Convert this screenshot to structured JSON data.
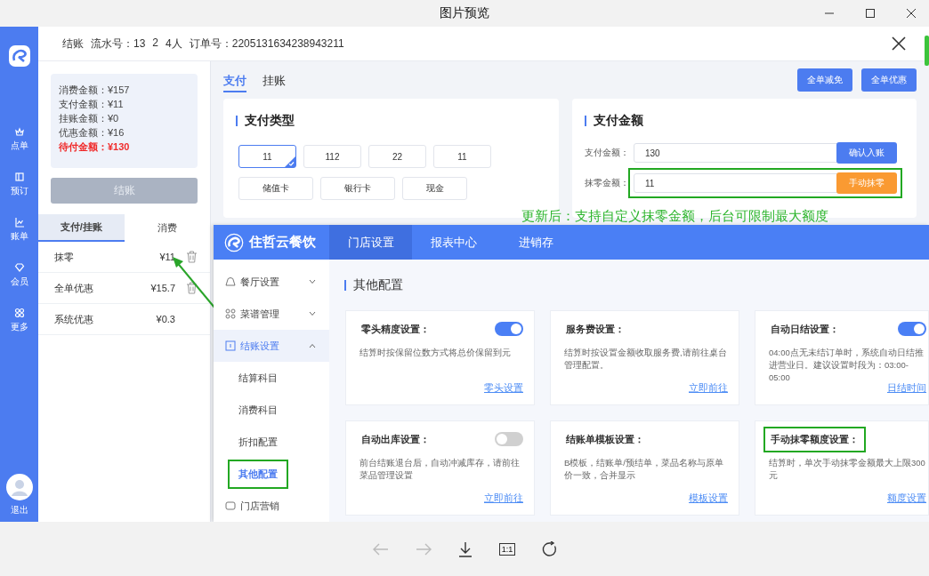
{
  "window": {
    "title": "图片预览"
  },
  "pos": {
    "nav": [
      {
        "label": "点单"
      },
      {
        "label": "预订"
      },
      {
        "label": "账单"
      },
      {
        "label": "会员"
      },
      {
        "label": "更多"
      }
    ],
    "logout": "退出",
    "header": {
      "title": "结账",
      "serial": "流水号：13",
      "table": "2",
      "guests": "4人",
      "order": "订单号：2205131634238943211"
    },
    "summary": [
      {
        "text": "消费金额：¥157",
        "kind": "normal"
      },
      {
        "text": "支付金额：¥11",
        "kind": "normal"
      },
      {
        "text": "挂账金额：¥0",
        "kind": "normal"
      },
      {
        "text": "优惠金额：¥16",
        "kind": "normal"
      },
      {
        "text": "待付金额：¥130",
        "kind": "due"
      }
    ],
    "checkout_button": {
      "label": "结账",
      "disabled": true
    },
    "list_tabs": [
      {
        "label": "支付/挂账",
        "selected": true
      },
      {
        "label": "消费",
        "selected": false
      }
    ],
    "entries": [
      {
        "name": "抹零",
        "amount": "¥11",
        "deletable": true
      },
      {
        "name": "全单优惠",
        "amount": "¥15.7",
        "deletable": true
      },
      {
        "name": "系统优惠",
        "amount": "¥0.3",
        "deletable": false
      }
    ],
    "pay_tabs": [
      {
        "label": "支付",
        "selected": true
      },
      {
        "label": "挂账",
        "selected": false
      }
    ],
    "actions": [
      "全单减免",
      "全单优惠"
    ],
    "pay_type": {
      "title": "支付类型",
      "options": [
        {
          "label": "11",
          "selected": true
        },
        {
          "label": "112",
          "selected": false
        },
        {
          "label": "22",
          "selected": false
        },
        {
          "label": "11",
          "selected": false
        },
        {
          "label": "储值卡",
          "selected": false
        },
        {
          "label": "银行卡",
          "selected": false
        },
        {
          "label": "现金",
          "selected": false
        }
      ]
    },
    "pay_amount": {
      "title": "支付金额",
      "rows": [
        {
          "label": "支付金额：",
          "value": "130",
          "button": "确认入账",
          "kind": "confirm",
          "highlighted": false
        },
        {
          "label": "抹零金额：",
          "value": "11",
          "button": "手动抹零",
          "kind": "manual",
          "highlighted": true
        }
      ]
    },
    "annotation": "更新后：支持自定义抹零金额，后台可限制最大额度"
  },
  "admin": {
    "brand": "住哲云餐饮",
    "tabs": [
      {
        "label": "门店设置",
        "selected": true
      },
      {
        "label": "报表中心",
        "selected": false
      },
      {
        "label": "进销存",
        "selected": false
      }
    ],
    "menu": [
      {
        "label": "餐厅设置",
        "expanded": false,
        "selected": false
      },
      {
        "label": "菜谱管理",
        "expanded": false,
        "selected": false
      },
      {
        "label": "结账设置",
        "expanded": true,
        "selected": true,
        "children": [
          {
            "label": "结算科目",
            "selected": false,
            "highlighted": false
          },
          {
            "label": "消费科目",
            "selected": false,
            "highlighted": false
          },
          {
            "label": "折扣配置",
            "selected": false,
            "highlighted": false
          },
          {
            "label": "其他配置",
            "selected": true,
            "highlighted": true
          }
        ]
      },
      {
        "label": "门店营销",
        "selected": false
      }
    ],
    "section_title": "其他配置",
    "cards": [
      {
        "title": "零头精度设置：",
        "kind": "toggle",
        "on": true,
        "desc": "结算时按保留位数方式将总价保留到元",
        "link": "零头设置",
        "highlighted": false
      },
      {
        "title": "服务费设置：",
        "kind": "plain",
        "desc": "结算时按设置金额收取服务费,请前往桌台管理配置。",
        "link": "立即前往",
        "highlighted": false
      },
      {
        "title": "自动日结设置：",
        "kind": "toggle",
        "on": true,
        "desc": "04:00点无未结订单时，系统自动日结推进营业日。建议设置时段为：03:00-05:00",
        "link": "日结时间",
        "highlighted": false
      },
      {
        "title": "自动出库设置：",
        "kind": "toggle",
        "on": false,
        "desc": "前台结账退台后，自动冲减库存，请前往菜品管理设置",
        "link": "立即前往",
        "highlighted": false
      },
      {
        "title": "结账单模板设置：",
        "kind": "plain",
        "desc": "B模板，结账单/预结单，菜品名称与原单价一致，合并显示",
        "link": "模板设置",
        "highlighted": false
      },
      {
        "title": "手动抹零额度设置：",
        "kind": "plain",
        "desc": "结算时，单次手动抹零金额最大上限300元",
        "link": "额度设置",
        "highlighted": true
      }
    ]
  },
  "viewer_toolbar": {
    "zoom_label": "1:1"
  }
}
